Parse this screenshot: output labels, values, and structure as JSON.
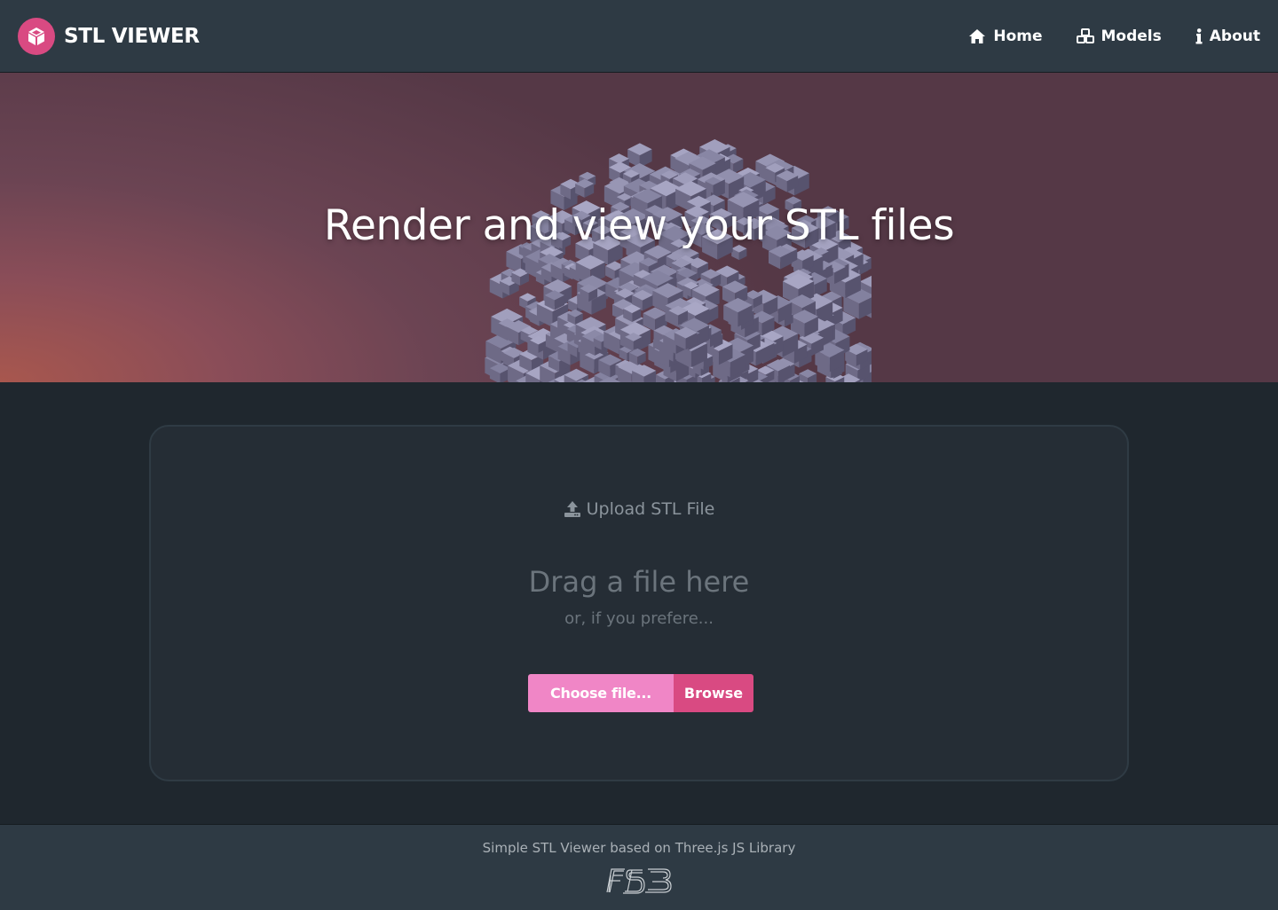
{
  "brand": {
    "name": "STL VIEWER",
    "logo_icon": "cube-icon",
    "accent": "#d94a82"
  },
  "nav": {
    "items": [
      {
        "label": "Home",
        "icon": "home-icon"
      },
      {
        "label": "Models",
        "icon": "cubes-icon"
      },
      {
        "label": "About",
        "icon": "info-icon"
      }
    ]
  },
  "hero": {
    "title": "Render and view your STL files"
  },
  "upload": {
    "heading": "Upload STL File",
    "heading_icon": "upload-icon",
    "drag_title": "Drag a file here",
    "drag_subtitle": "or, if you prefere...",
    "choose_label": "Choose file...",
    "browse_label": "Browse",
    "choose_color": "#f086c6",
    "browse_color": "#d94a82"
  },
  "footer": {
    "text": "Simple STL Viewer based on Three.js JS Library",
    "logo_text": "FESB"
  }
}
